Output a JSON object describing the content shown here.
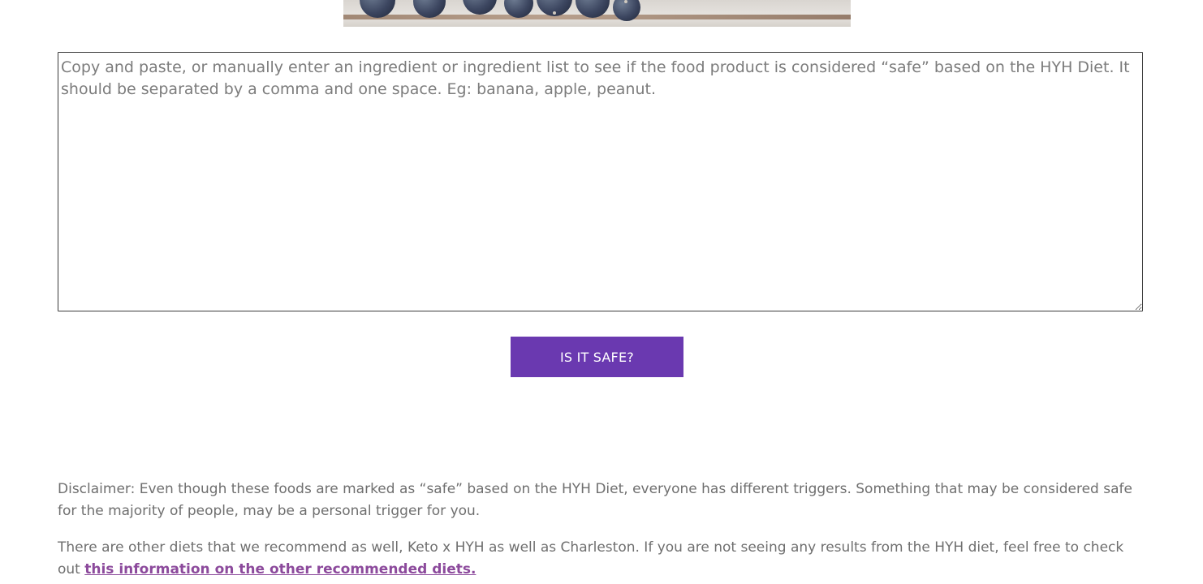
{
  "hero": {
    "image_icon": "blueberries-photo"
  },
  "ingredient_checker": {
    "placeholder": "Copy and paste, or manually enter an ingredient or ingredient list to see if the food product is considered “safe” based on the HYH Diet. It should be separated by a comma and one space. Eg: banana, apple, peanut.",
    "value": "",
    "button_label": "IS IT SAFE?"
  },
  "disclaimer": {
    "text": "Disclaimer: Even though these foods are marked as “safe” based on the HYH Diet, everyone has different triggers. Something that may be considered safe for the majority of people, may be a personal trigger for you."
  },
  "other_diets": {
    "text": "There are other diets that we recommend as well, Keto x HYH as well as Charleston. If you are not seeing any results from the HYH diet, feel free to check out ",
    "link_label": "this information on the other recommended diets."
  },
  "colors": {
    "button_bg": "#6a39b0",
    "link": "#8c4a9c",
    "body_text": "#6f6f6f"
  }
}
